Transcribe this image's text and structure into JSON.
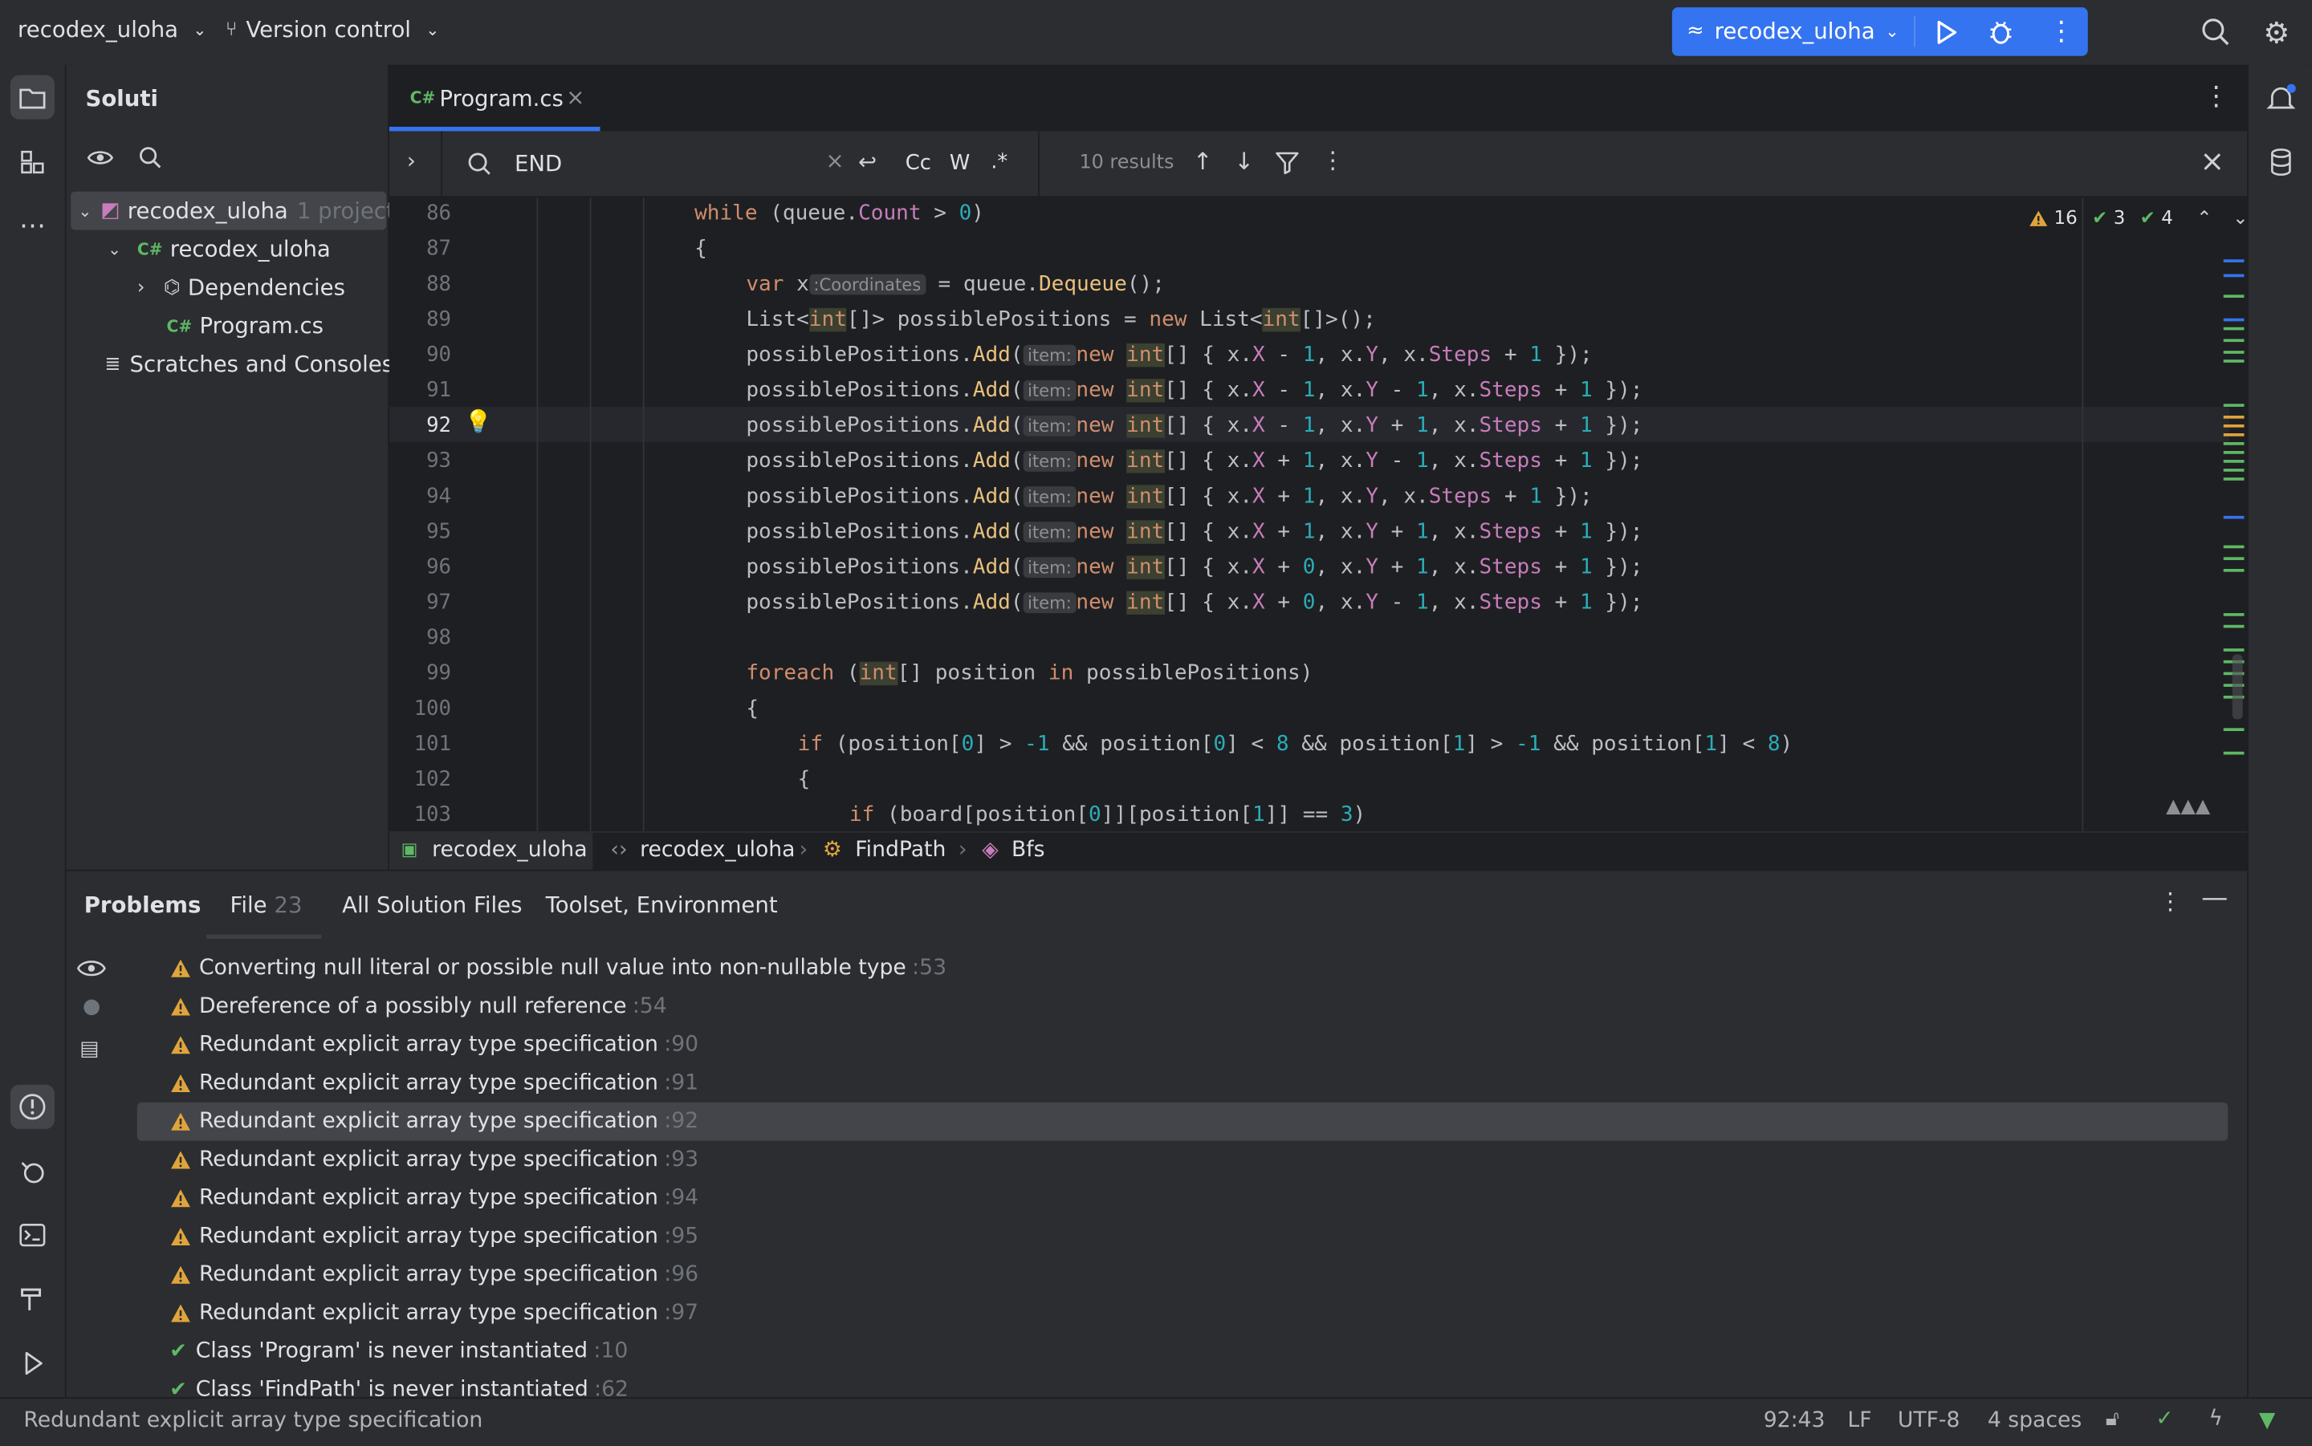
{
  "titlebar": {
    "project": "recodex_uloha",
    "vcs": "Version control",
    "run_config": "recodex_uloha"
  },
  "project_panel": {
    "title": "Soluti",
    "tree": [
      {
        "label": "recodex_uloha",
        "suffix": "1 project"
      },
      {
        "label": "recodex_uloha"
      },
      {
        "label": "Dependencies"
      },
      {
        "label": "Program.cs"
      },
      {
        "label": "Scratches and Consoles"
      }
    ]
  },
  "editor": {
    "tab": "Program.cs",
    "tab_lang": "C#",
    "find": {
      "query": "END",
      "case": "Cc",
      "word": "W",
      "regex": ".*",
      "results": "10 results"
    },
    "inspections": {
      "warnings": "16",
      "ok": "3",
      "typos": "4"
    },
    "lines": [
      "86",
      "87",
      "88",
      "89",
      "90",
      "91",
      "92",
      "93",
      "94",
      "95",
      "96",
      "97",
      "98",
      "99",
      "100",
      "101",
      "102",
      "103"
    ],
    "inline_hint_type": ":Coordinates",
    "inline_hint_param": "item:"
  },
  "breadcrumb": [
    "recodex_uloha",
    "recodex_uloha",
    "FindPath",
    "Bfs"
  ],
  "problems": {
    "tabs": [
      {
        "label": "Problems"
      },
      {
        "label": "File",
        "count": "23"
      },
      {
        "label": "All Solution Files"
      },
      {
        "label": "Toolset, Environment"
      }
    ],
    "items": [
      {
        "text": "Converting null literal or possible null value into non-nullable type",
        "line": ":53",
        "kind": "warning"
      },
      {
        "text": "Dereference of a possibly null reference",
        "line": ":54",
        "kind": "warning"
      },
      {
        "text": "Redundant explicit array type specification",
        "line": ":90",
        "kind": "warning"
      },
      {
        "text": "Redundant explicit array type specification",
        "line": ":91",
        "kind": "warning"
      },
      {
        "text": "Redundant explicit array type specification",
        "line": ":92",
        "kind": "warning"
      },
      {
        "text": "Redundant explicit array type specification",
        "line": ":93",
        "kind": "warning"
      },
      {
        "text": "Redundant explicit array type specification",
        "line": ":94",
        "kind": "warning"
      },
      {
        "text": "Redundant explicit array type specification",
        "line": ":95",
        "kind": "warning"
      },
      {
        "text": "Redundant explicit array type specification",
        "line": ":96",
        "kind": "warning"
      },
      {
        "text": "Redundant explicit array type specification",
        "line": ":97",
        "kind": "warning"
      },
      {
        "text": "Class 'Program' is never instantiated",
        "line": ":10",
        "kind": "info"
      },
      {
        "text": "Class 'FindPath' is never instantiated",
        "line": ":62",
        "kind": "info"
      }
    ]
  },
  "status": {
    "message": "Redundant explicit array type specification",
    "position": "92:43",
    "line_sep": "LF",
    "encoding": "UTF-8",
    "indent": "4 spaces"
  },
  "colors": {
    "accent": "#3574f0",
    "warning": "#e0a43c",
    "ok": "#5fb865"
  }
}
